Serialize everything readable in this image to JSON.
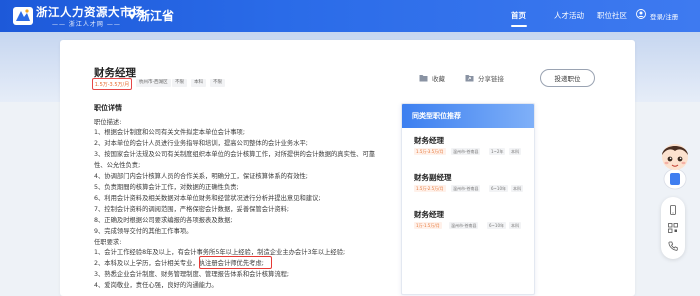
{
  "header": {
    "logo_title": "浙江人力资源大市场",
    "logo_sub": "—— 浙江人才网 ——",
    "region": "浙江省",
    "nav": [
      "首页",
      "人才活动",
      "职位社区"
    ],
    "login": "登录/注册",
    "active_nav_index": 0
  },
  "job": {
    "title": "财务经理",
    "salary": "1.5万-3.5万/月",
    "tags": [
      "杭州市-西湖区",
      "不限",
      "本科",
      "不限"
    ],
    "actions": {
      "collect": "收藏",
      "share": "分享链接"
    },
    "deliver": "投递职位"
  },
  "detail": {
    "section_title": "职位详情",
    "lines": [
      "职位描述:",
      "1、根据会计制度和公司有关文件拟定本单位会计事项;",
      "2、对本单位的会计人员进行业务指导和培训，提高公司整体的会计业务水平;",
      "3、按国家会计法规及公司有关制度组织本单位的会计核算工作，对所提供的会计数据的真实性、可靠",
      "性、公允性负责;",
      "4、协调部门内会计核算人员的合作关系，明确分工，保证核算体系的有效性;",
      "5、负责期間的核算会计工作，对数据的正确性负责;",
      "6、利用会计资料及相关数据对本单位财务和经营状况进行分析并提出意见和建议;",
      "7、控制会计资料的调阅范围，严格保密会计数据，妥善保管会计资料;",
      "8、正确及时根据公司要求编报的各项报表及数据;",
      "9、完成领导交付的其他工作事项。",
      "任职要求:",
      "1、会计工作经验8年及以上，有会计事务所5年以上经验，制造企业主办会计3年以上经验;",
      "2、本科及以上学历，会计相关专业，执注册会计师优先考虑;",
      "3、熟悉企业会计制度、财务管理制度、管理报告体系和会计核算流程;",
      "4、爱岗敬业，责任心强，良好的沟通能力。"
    ]
  },
  "recommend": {
    "title": "同类型职位推荐",
    "items": [
      {
        "name": "财务经理",
        "salary": "1.5万-3.5万/月",
        "tags": [
          "温州市-苍南县",
          "1~2年",
          "本科"
        ]
      },
      {
        "name": "财务副经理",
        "salary": "1.5万-2.5万/月",
        "tags": [
          "温州市-苍南县",
          "6~10年",
          "本科"
        ]
      },
      {
        "name": "财务经理",
        "salary": "1万-1.5万/月",
        "tags": [
          "温州市-苍南县",
          "6~10年",
          "本科"
        ]
      }
    ]
  },
  "icons": {
    "brand_color": "#2563e6",
    "highlight_color": "#e53935",
    "side_tools": [
      "mobile-icon",
      "qrcode-icon",
      "phone-icon"
    ]
  }
}
